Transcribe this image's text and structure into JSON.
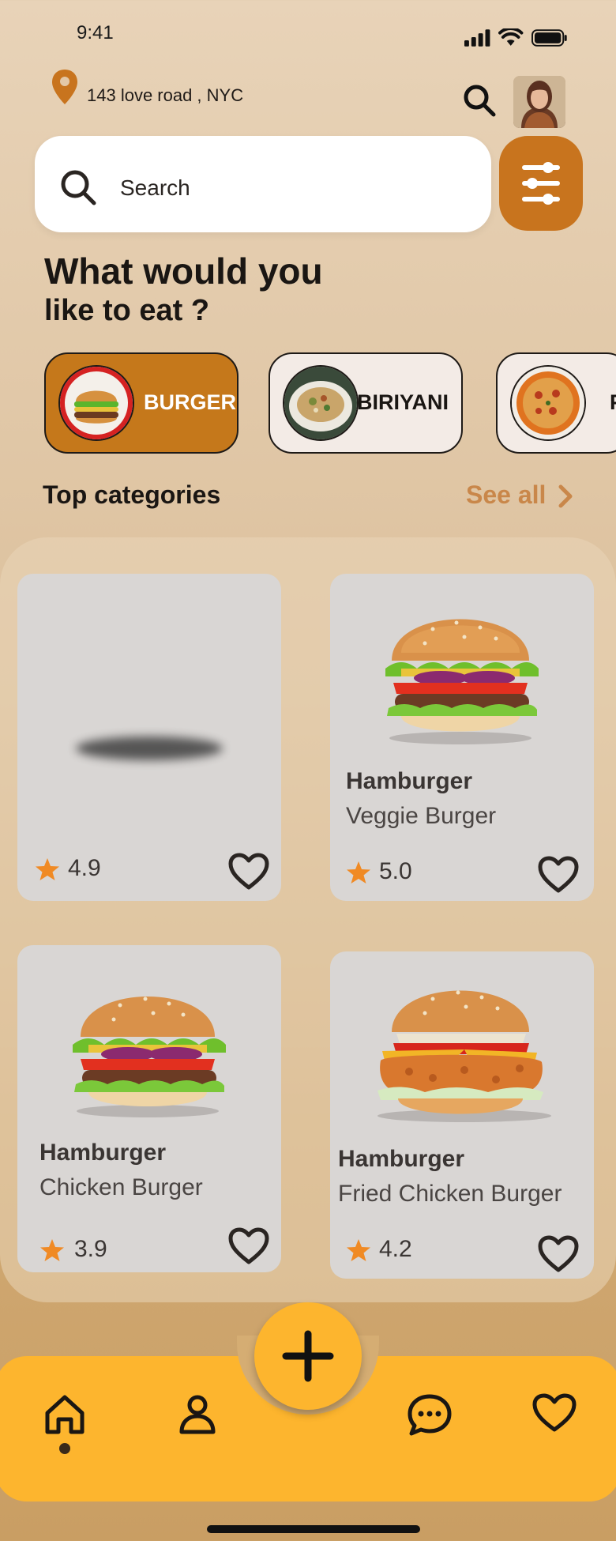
{
  "status_bar": {
    "time": "9:41"
  },
  "header": {
    "location": "143 love road , NYC"
  },
  "search": {
    "placeholder": "Search"
  },
  "heading": {
    "line1": "What would you",
    "line2": "like to eat ?"
  },
  "chips": [
    {
      "label": "BURGER",
      "selected": true
    },
    {
      "label": "BIRIYANI",
      "selected": false
    },
    {
      "label": "P",
      "selected": false
    }
  ],
  "top_categories": {
    "title": "Top categories",
    "see_all": "See all"
  },
  "cards": [
    {
      "title": "",
      "subtitle": "",
      "rating": "4.9"
    },
    {
      "title": "Hamburger",
      "subtitle": "Veggie Burger",
      "rating": "5.0"
    },
    {
      "title": "Hamburger",
      "subtitle": "Chicken Burger",
      "rating": "3.9"
    },
    {
      "title": "Hamburger",
      "subtitle": "Fried Chicken Burger",
      "rating": "4.2"
    }
  ],
  "nav": {
    "items": [
      "home-icon",
      "profile-icon",
      "add-icon",
      "chat-icon",
      "heart-icon"
    ],
    "active": "home"
  },
  "colors": {
    "accent": "#c8741e",
    "nav": "#fdb52e",
    "star": "#f08a24",
    "see_all": "#c9874a"
  }
}
